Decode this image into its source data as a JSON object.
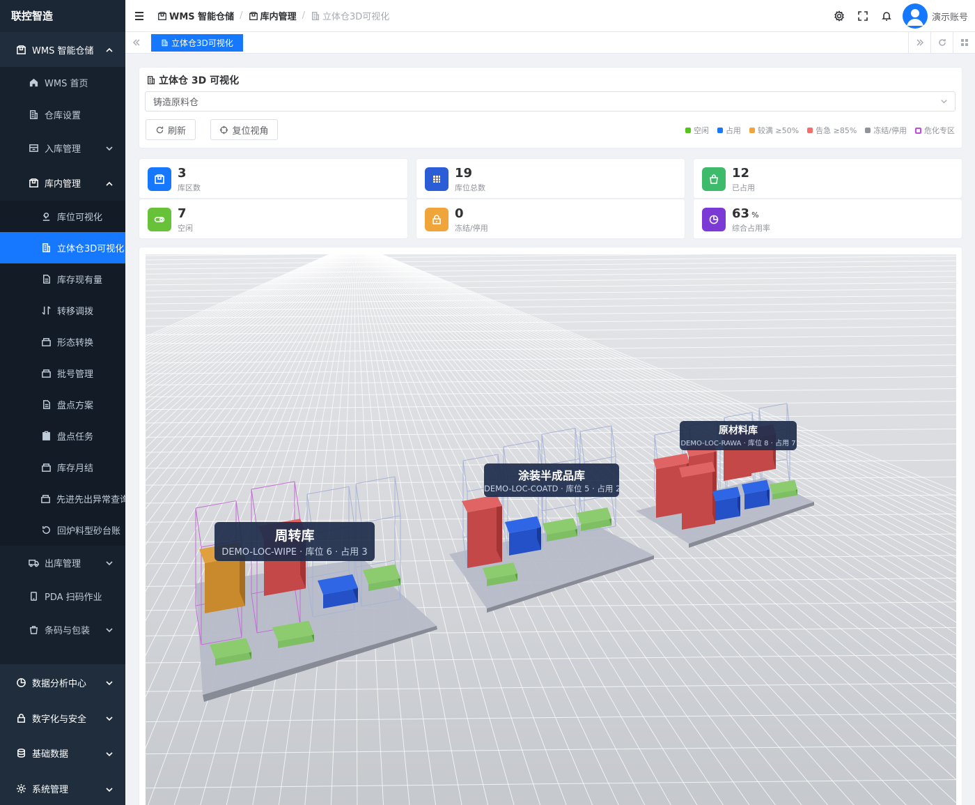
{
  "brand": "联控智造",
  "sidebar": {
    "top_group": "WMS 智能仓储",
    "items": [
      {
        "label": "WMS 首页"
      },
      {
        "label": "仓库设置"
      },
      {
        "label": "入库管理"
      },
      {
        "label": "库内管理"
      }
    ],
    "sub_items": [
      {
        "label": "库位可视化"
      },
      {
        "label": "立体仓3D可视化"
      },
      {
        "label": "库存现有量"
      },
      {
        "label": "转移调拨"
      },
      {
        "label": "形态转换"
      },
      {
        "label": "批号管理"
      },
      {
        "label": "盘点方案"
      },
      {
        "label": "盘点任务"
      },
      {
        "label": "库存月结"
      },
      {
        "label": "先进先出异常查询"
      },
      {
        "label": "回炉料型砂台账"
      }
    ],
    "items_after": [
      {
        "label": "出库管理"
      },
      {
        "label": "PDA 扫码作业"
      },
      {
        "label": "条码与包装"
      }
    ],
    "bottom_groups": [
      {
        "label": "数据分析中心"
      },
      {
        "label": "数字化与安全"
      },
      {
        "label": "基础数据"
      },
      {
        "label": "系统管理"
      }
    ]
  },
  "header": {
    "breadcrumb": [
      "WMS 智能仓储",
      "库内管理",
      "立体仓3D可视化"
    ],
    "user": "演示账号"
  },
  "tabs": {
    "active": "立体仓3D可视化"
  },
  "panel": {
    "title": "立体仓 3D 可视化",
    "warehouse_select": "铸造原料仓",
    "refresh_btn": "刷新",
    "reset_view_btn": "复位视角",
    "legend": [
      {
        "label": "空闲",
        "color": "#52c41a"
      },
      {
        "label": "占用",
        "color": "#1677ff"
      },
      {
        "label": "较满 ≥50%",
        "color": "#f0a53b"
      },
      {
        "label": "告急 ≥85%",
        "color": "#f56c6c"
      },
      {
        "label": "冻结/停用",
        "color": "#909399"
      },
      {
        "label": "危化专区",
        "color": "#c04ddd"
      }
    ]
  },
  "stats": [
    {
      "value": "3",
      "label": "库区数",
      "color": "#1677ff",
      "icon": "box-icon"
    },
    {
      "value": "19",
      "label": "库位总数",
      "color": "#2b5ed6",
      "icon": "grid-icon"
    },
    {
      "value": "12",
      "label": "已占用",
      "color": "#3dbb6a",
      "icon": "bag-icon"
    },
    {
      "value": "7",
      "label": "空闲",
      "color": "#67c23a",
      "icon": "toggle-icon"
    },
    {
      "value": "0",
      "label": "冻结/停用",
      "color": "#f0a53b",
      "icon": "lock-icon"
    },
    {
      "value": "63",
      "unit": "%",
      "label": "综合占用率",
      "color": "#7b3ad6",
      "icon": "pie-icon"
    }
  ],
  "zones": [
    {
      "name": "周转库",
      "sub": "DEMO-LOC-WIPE · 库位 6 · 占用 3"
    },
    {
      "name": "涂装半成品库",
      "sub": "DEMO-LOC-COATD · 库位 5 · 占用 2"
    },
    {
      "name": "原材料库",
      "sub": "DEMO-LOC-RAWA · 库位 8 · 占用 7"
    }
  ]
}
